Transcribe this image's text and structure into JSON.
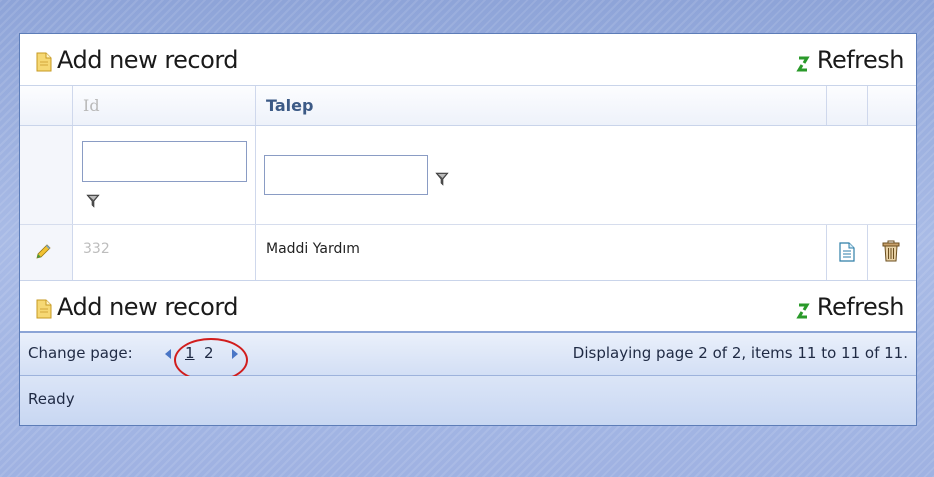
{
  "commands": {
    "add_label": "Add new record",
    "refresh_label": "Refresh"
  },
  "columns": [
    "Id",
    "Talep"
  ],
  "filters": {
    "id_value": "",
    "talep_value": ""
  },
  "rows": [
    {
      "id": "332",
      "talep": "Maddi Yardım"
    }
  ],
  "pager": {
    "label": "Change page:",
    "pages": [
      "1",
      "2"
    ],
    "info": "Displaying page 2 of 2, items 11 to 11 of 11."
  },
  "status": "Ready",
  "colors": {
    "accent": "#4a76c6",
    "header_text": "#3c5a86",
    "highlight_circle": "#d11d1d",
    "refresh_green": "#2a9a2a"
  },
  "icons": [
    "document-add-icon",
    "refresh-icon",
    "filter-icon",
    "pencil-edit-icon",
    "document-icon",
    "trash-icon",
    "prev-arrow-icon",
    "next-arrow-icon"
  ]
}
